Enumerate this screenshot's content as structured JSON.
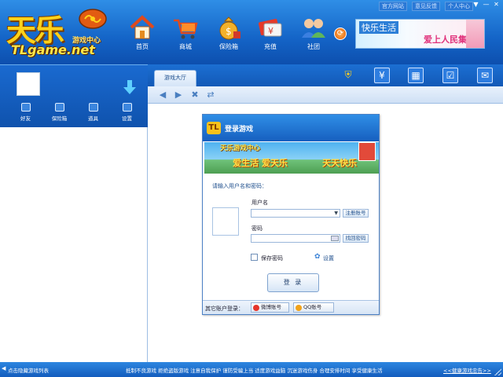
{
  "logo": {
    "main": "天乐",
    "sub": "游戏中心",
    "domain": "TLgame.net"
  },
  "nav": [
    {
      "label": "首页",
      "icon": "home-icon"
    },
    {
      "label": "商城",
      "icon": "shopping-cart-icon"
    },
    {
      "label": "保险箱",
      "icon": "money-bag-icon"
    },
    {
      "label": "充值",
      "icon": "card-recharge-icon"
    },
    {
      "label": "社团",
      "icon": "group-icon"
    }
  ],
  "top_links": [
    "官方网站",
    "意见反馈",
    "个人中心"
  ],
  "window_controls": [
    "▼",
    "—",
    "✕"
  ],
  "banner": {
    "line1": "快乐生活",
    "line2": "爱上人民集体"
  },
  "left_tools": [
    {
      "label": "好友",
      "icon": "friends-icon"
    },
    {
      "label": "保险箱",
      "icon": "safe-icon"
    },
    {
      "label": "道具",
      "icon": "props-icon"
    },
    {
      "label": "设置",
      "icon": "settings-icon"
    }
  ],
  "lobby_tab": "游戏大厅",
  "right_icons": [
    "shield-icon",
    "yen-icon",
    "gift-icon",
    "checkbox-icon",
    "mail-icon"
  ],
  "login": {
    "title": "登录游戏",
    "banner_top": "天乐游戏中心",
    "banner_slogan1": "爱生活  爱天乐",
    "banner_slogan2": "天天快乐",
    "prompt": "请输入用户名和密码：",
    "username_label": "用户名",
    "username_value": "",
    "register_link": "注册账号",
    "password_label": "密码",
    "password_value": "",
    "recover_link": "找回密码",
    "remember_label": "保存密码",
    "settings_label": "设置",
    "login_button": "登 录",
    "other_login_label": "其它账户登录：",
    "other_accounts": [
      "微博账号",
      "QQ账号"
    ]
  },
  "status": {
    "left_text": "点击隐藏游戏列表",
    "notice": "抵制不良游戏 拒绝盗版游戏 注意自我保护 谨防受骗上当 适度游戏益脑 沉迷游戏伤身 合理安排时间 享受健康生活",
    "link": "<<健康游戏忠告>>"
  },
  "colors": {
    "header": "#1464c7",
    "accent_yellow": "#ffd21a",
    "link_blue": "#1f4f8d"
  }
}
